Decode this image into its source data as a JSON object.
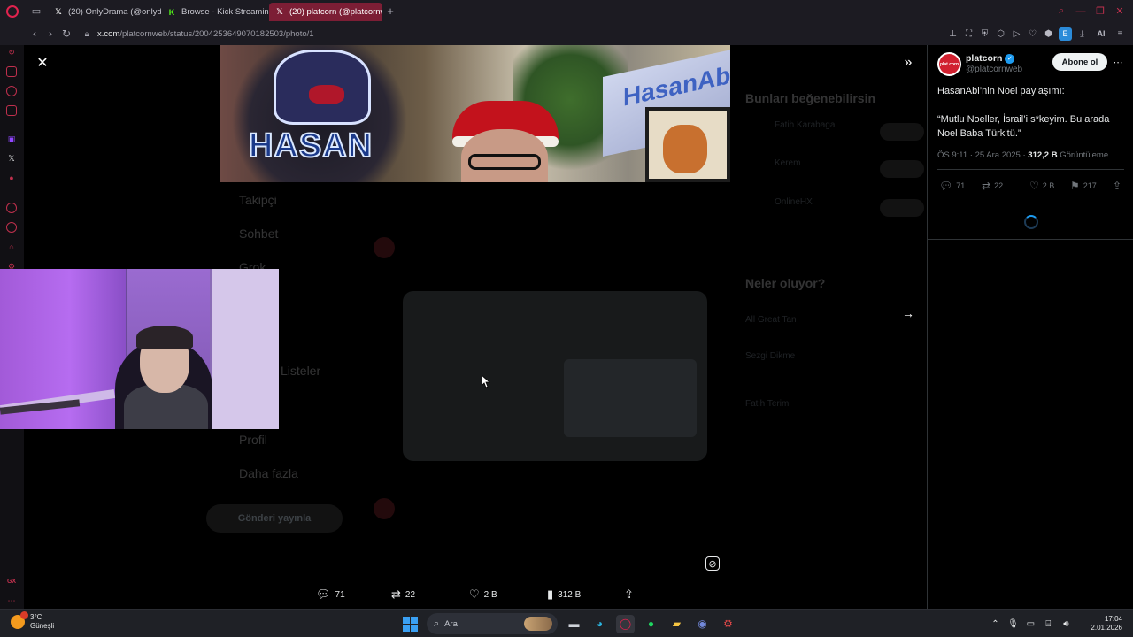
{
  "browser": {
    "tabs": [
      {
        "label": "(20) OnlyDrama (@onlydrama",
        "favicon": "X",
        "active": false
      },
      {
        "label": "Browse - Kick Streaming",
        "favicon": "K",
        "active": false
      },
      {
        "label": "(20) platcorn (@platcornwe",
        "favicon": "X",
        "active": true
      }
    ],
    "new_tab": "+",
    "url_domain": "x.com",
    "url_path": "/platcornweb/status/2004253649070182503/photo/1",
    "ai_label": "AI",
    "ext_label": "E"
  },
  "page": {
    "dimmed_nav": [
      "Takipçi",
      "Sohbet",
      "Grok",
      "Listeler",
      "Profil",
      "Daha fazla"
    ],
    "post_button": "Gönderi yayınla",
    "dimmed_trends_title": "Neler oluyor?",
    "dimmed_suggestions_title": "Bunları beğenebilirsin",
    "dimmed_trends": [
      "All Great Tan",
      "Sezgi Dikme",
      "Fatih Terim"
    ],
    "dimmed_suggestions": [
      "Fatih Karabaga",
      "Kerem",
      "OnlineHX"
    ]
  },
  "photo_actions": {
    "replies": "71",
    "reposts": "22",
    "likes": "2 B",
    "views": "312 B"
  },
  "tweet": {
    "display_name": "platcorn",
    "handle": "@platcornweb",
    "avatar_text": "plat corn",
    "follow_label": "Abone ol",
    "line1": "HasanAbi’nin Noel paylaşımı:",
    "line2": "“Mutlu Noeller, İsrail’i s*keyim. Bu arada Noel Baba Türk’tü.”",
    "time": "ÖS 9:11 · 25 Ara 2025 ·",
    "views_count": "312,2 B",
    "views_label": "Görüntüleme",
    "replies": "71",
    "reposts": "22",
    "likes": "2 B",
    "bookmarks": "217"
  },
  "taskbar": {
    "weather_temp": "3°C",
    "weather_desc": "Güneşli",
    "search_label": "Ara",
    "time": "17:04",
    "date": "2.01.2026"
  },
  "colors": {
    "accent": "#e0234e",
    "x_blue": "#1d9bf0",
    "kick_green": "#53fc18"
  }
}
